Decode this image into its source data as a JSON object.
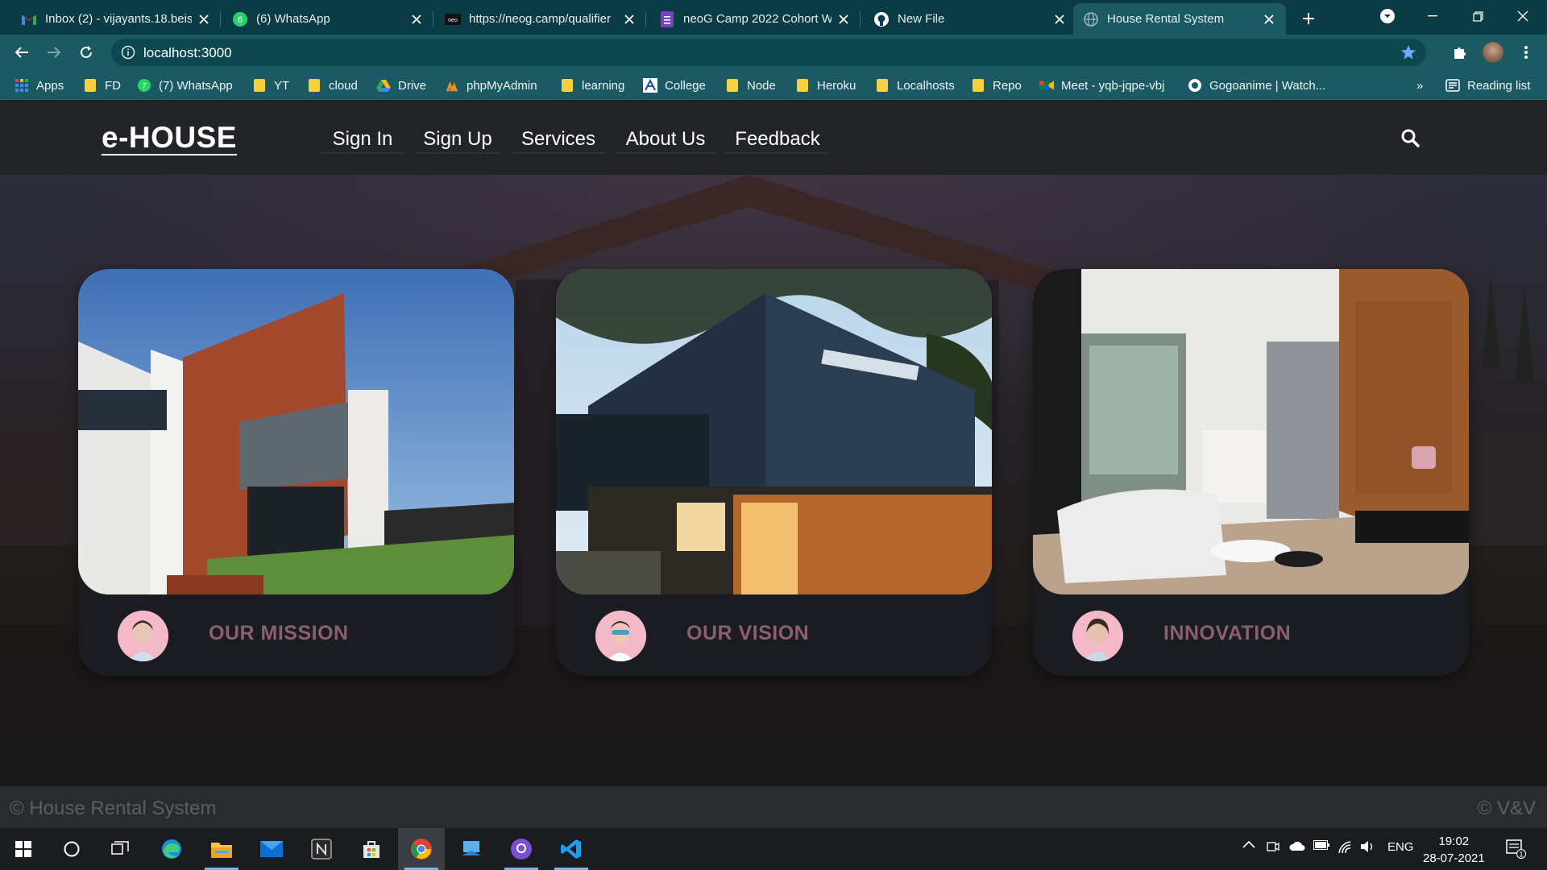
{
  "browser": {
    "tabs": [
      {
        "title": "Inbox (2) - vijayants.18.beis",
        "icon": "gmail-icon"
      },
      {
        "title": "(6) WhatsApp",
        "icon": "whatsapp-icon"
      },
      {
        "title": "https://neog.camp/qualifier",
        "icon": "neog-icon"
      },
      {
        "title": "neoG Camp 2022 Cohort W",
        "icon": "forms-icon"
      },
      {
        "title": "New File",
        "icon": "github-icon"
      },
      {
        "title": "House Rental System",
        "icon": "globe-icon"
      }
    ],
    "url": "localhost:3000",
    "bookmarks": [
      {
        "label": "Apps",
        "icon": "apps-grid-icon"
      },
      {
        "label": "FD",
        "icon": "folder-icon"
      },
      {
        "label": "(7) WhatsApp",
        "icon": "whatsapp-icon"
      },
      {
        "label": "YT",
        "icon": "folder-icon"
      },
      {
        "label": "cloud",
        "icon": "folder-icon"
      },
      {
        "label": "Drive",
        "icon": "drive-icon"
      },
      {
        "label": "phpMyAdmin",
        "icon": "phpmyadmin-icon"
      },
      {
        "label": "learning",
        "icon": "folder-icon"
      },
      {
        "label": "College",
        "icon": "college-icon"
      },
      {
        "label": "Node",
        "icon": "folder-icon"
      },
      {
        "label": "Heroku",
        "icon": "folder-icon"
      },
      {
        "label": "Localhosts",
        "icon": "folder-icon"
      },
      {
        "label": "Repo",
        "icon": "folder-icon"
      },
      {
        "label": "Meet - yqb-jqpe-vbj",
        "icon": "meet-icon"
      },
      {
        "label": "Gogoanime | Watch...",
        "icon": "gogoanime-icon"
      }
    ],
    "overflow_label": "»",
    "reading_list": "Reading list"
  },
  "site": {
    "logo": "e-HOUSE",
    "nav": [
      "Sign In",
      "Sign Up",
      "Services",
      "About Us",
      "Feedback"
    ],
    "cards": [
      {
        "caption": "OUR MISSION"
      },
      {
        "caption": "OUR VISION"
      },
      {
        "caption": "INNOVATION"
      }
    ],
    "footer_left": "© House Rental System",
    "footer_right": "© V&V"
  },
  "taskbar": {
    "language": "ENG",
    "time": "19:02",
    "date": "28-07-2021",
    "notification_count": "1"
  },
  "colors": {
    "tab_strip": "#0b3c45",
    "toolbar": "#1b5963",
    "site_nav": "#232428",
    "card_caption": "#8b5f6e"
  }
}
